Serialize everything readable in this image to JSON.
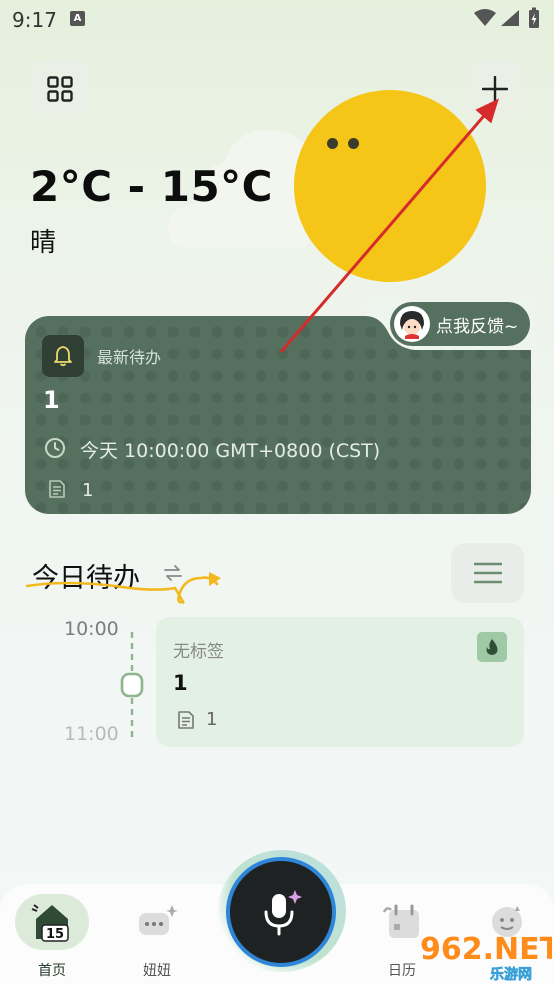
{
  "status_bar": {
    "time": "9:17",
    "notification_letter": "A"
  },
  "weather": {
    "temperature_range": "2°C - 15°C",
    "condition": "晴"
  },
  "feedback": {
    "label": "点我反馈~"
  },
  "latest_todo": {
    "header": "最新待办",
    "title": "1",
    "time": "今天 10:00:00 GMT+0800 (CST)",
    "note_count": "1"
  },
  "today": {
    "title": "今日待办",
    "timeline_start": "10:00",
    "timeline_end": "11:00",
    "task": {
      "tag": "无标签",
      "title": "1",
      "note_count": "1"
    }
  },
  "bottom_nav": {
    "items": [
      {
        "label": "首页",
        "icon": "home-icon",
        "active": true
      },
      {
        "label": "妞妞",
        "icon": "chat-bubble-icon",
        "active": false
      },
      {
        "label": "",
        "icon": "microphone-icon",
        "active": false
      },
      {
        "label": "日历",
        "icon": "calendar-icon",
        "active": false
      },
      {
        "label": "",
        "icon": "profile-icon",
        "active": false
      }
    ],
    "home_badge": "15"
  },
  "watermark": {
    "text": "962.NET",
    "subtext": "乐游网"
  },
  "colors": {
    "card_green": "#56705f",
    "sun_yellow": "#f5c518",
    "task_card_bg": "#e2f1e3",
    "annotation_red": "#d62b2b",
    "mic_ring_blue": "#2f86d8"
  }
}
